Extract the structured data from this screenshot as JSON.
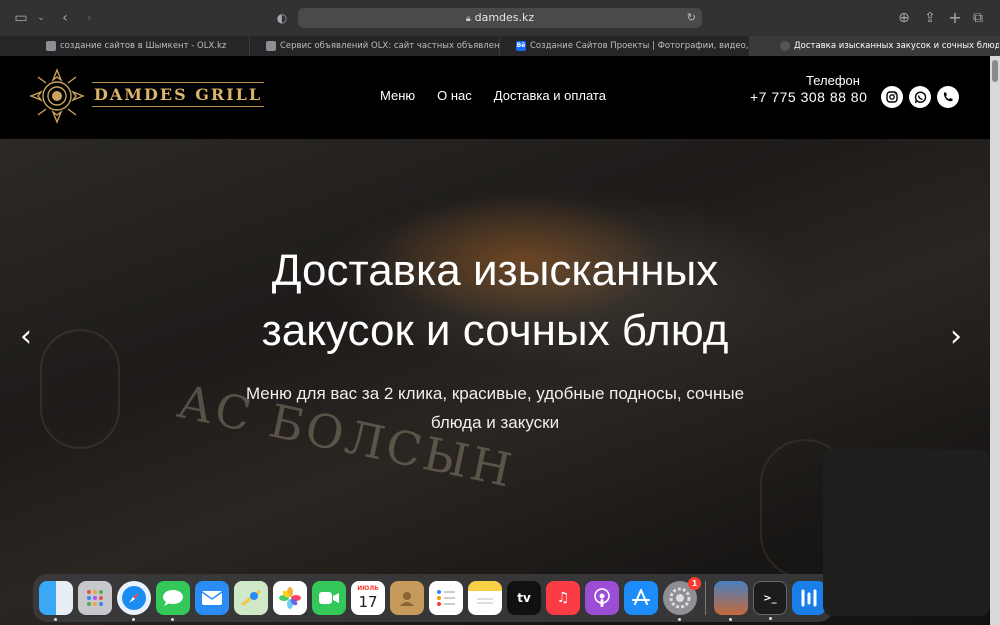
{
  "browser": {
    "url": "damdes.kz",
    "tabs": [
      {
        "label": "создание сайтов в Шымкент - OLX.kz",
        "active": false
      },
      {
        "label": "Сервис объявлений OLX: сайт частных объявлений...",
        "active": false
      },
      {
        "label": "Создание Сайтов Проекты | Фотографии, видео, лог...",
        "active": false,
        "favicon_text": "Bē"
      },
      {
        "label": "Доставка изысканных закусок и сочных блюд",
        "active": true
      }
    ]
  },
  "header": {
    "logo_text": "DAMDES GRILL",
    "nav": [
      "Меню",
      "О нас",
      "Доставка и оплата"
    ],
    "phone_label": "Телефон",
    "phone_number": "+7 775 308 88 80",
    "social_icons": [
      "instagram-icon",
      "whatsapp-icon",
      "phone-icon"
    ]
  },
  "hero": {
    "title_line1": "Доставка изысканных",
    "title_line2": "закусок и сочных блюд",
    "subtitle_line1": "Меню для вас за 2 клика, красивые, удобные подносы, сочные",
    "subtitle_line2": "блюда и закуски",
    "box_text": "АС БОЛСЫН",
    "prev_arrow": "‹",
    "next_arrow": "›"
  },
  "dock": {
    "calendar_month": "ИЮЛЬ",
    "calendar_day": "17",
    "settings_badge": "1",
    "tv_label": "tv",
    "items": [
      "finder-icon",
      "launchpad-icon",
      "safari-icon",
      "messages-icon",
      "mail-icon",
      "maps-icon",
      "photos-icon",
      "facetime-icon",
      "calendar-icon",
      "contacts-icon",
      "reminders-icon",
      "notes-icon",
      "tv-icon",
      "music-icon",
      "podcasts-icon",
      "appstore-icon",
      "settings-icon",
      "game-icon",
      "terminal-icon",
      "app-icon"
    ]
  },
  "colors": {
    "gold": "#d9b46a",
    "header_bg": "#000000",
    "browser_chrome": "#323234"
  }
}
